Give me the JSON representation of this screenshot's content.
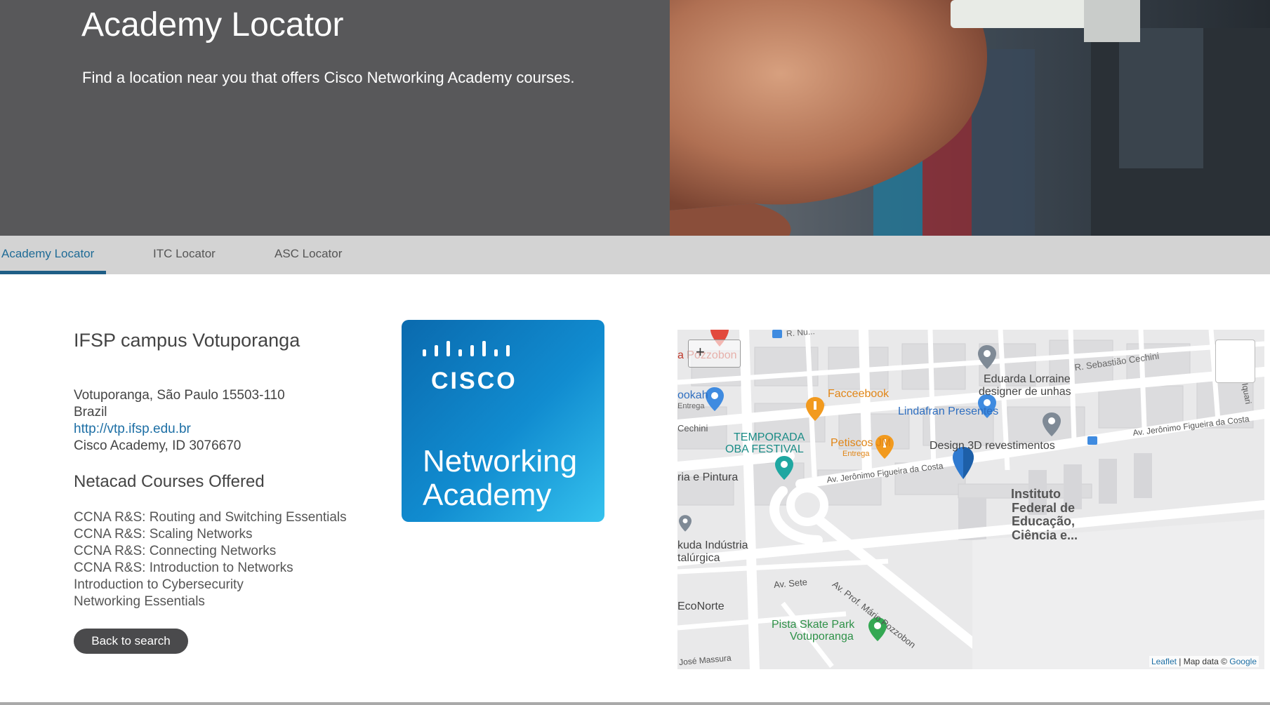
{
  "hero": {
    "title": "Academy Locator",
    "subtitle": "Find a location near you that offers Cisco Networking Academy courses."
  },
  "tabs": [
    {
      "label": "Academy Locator",
      "active": true
    },
    {
      "label": "ITC Locator",
      "active": false
    },
    {
      "label": "ASC Locator",
      "active": false
    }
  ],
  "academy": {
    "name": "IFSP campus Votuporanga",
    "city_line": "Votuporanga, São Paulo 15503-110",
    "country": "Brazil",
    "website": "http://vtp.ifsp.edu.br",
    "academy_id": "Cisco Academy, ID 3076670"
  },
  "courses": {
    "title": "Netacad Courses Offered",
    "items": [
      "CCNA R&S: Routing and Switching Essentials",
      "CCNA R&S: Scaling Networks",
      "CCNA R&S: Connecting Networks",
      "CCNA R&S: Introduction to Networks",
      "Introduction to Cybersecurity",
      "Networking Essentials"
    ]
  },
  "back_button": "Back to search",
  "logo": {
    "wordmark": "CISCO",
    "line1": "Networking",
    "line2": "Academy"
  },
  "map": {
    "labels": {
      "pozzobon": "a Pozzobon",
      "r_nunes": "R. Nu...",
      "sebastiao": "R. Sebastião Cechini",
      "eduarda": "Eduarda Lorraine",
      "eduarda2": "designer de unhas",
      "facceebook": "Facceebook",
      "lindafran": "Lindafran Presentes",
      "hookah": "ookah",
      "entrega1": "Entrega",
      "cechini": "Cechini",
      "temporada": "TEMPORADA",
      "oba": "OBA FESTIVAL",
      "petiscos": "Petiscos JM",
      "entrega2": "Entrega",
      "design3d": "Design 3D revestimentos",
      "av_jeronimo1": "Av. Jerônimo Figueira da Costa",
      "av_jeronimo2": "Av. Jerônimo Figueira da Costa",
      "pintura": "ria e Pintura",
      "instituto1": "Instituto",
      "instituto2": "Federal de",
      "instituto3": "Educação,",
      "instituto4": "Ciência e...",
      "kuda1": "kuda Indústria",
      "kuda2": "talúrgica",
      "av_mario": "Av. Prof. Mário Pozzobon",
      "av_sete": "Av. Sete",
      "econorte": "EcoNorte",
      "skate1": "Pista Skate Park",
      "skate2": "Votuporanga",
      "jose": "José Massura",
      "iquari": "Iquari"
    },
    "attribution": {
      "leaflet": "Leaflet",
      "mapdata": " | Map data © ",
      "google": "Google"
    },
    "zoom_plus": "+"
  },
  "colors": {
    "hero_bg": "#58585a",
    "tab_bg": "#d3d3d3",
    "tab_active": "#1f6b96",
    "link": "#1d6fa5",
    "pin_blue": "#2f7ad0",
    "pin_gray": "#7f8a96",
    "food_orange": "#f29a1e",
    "park_green": "#34a853"
  }
}
